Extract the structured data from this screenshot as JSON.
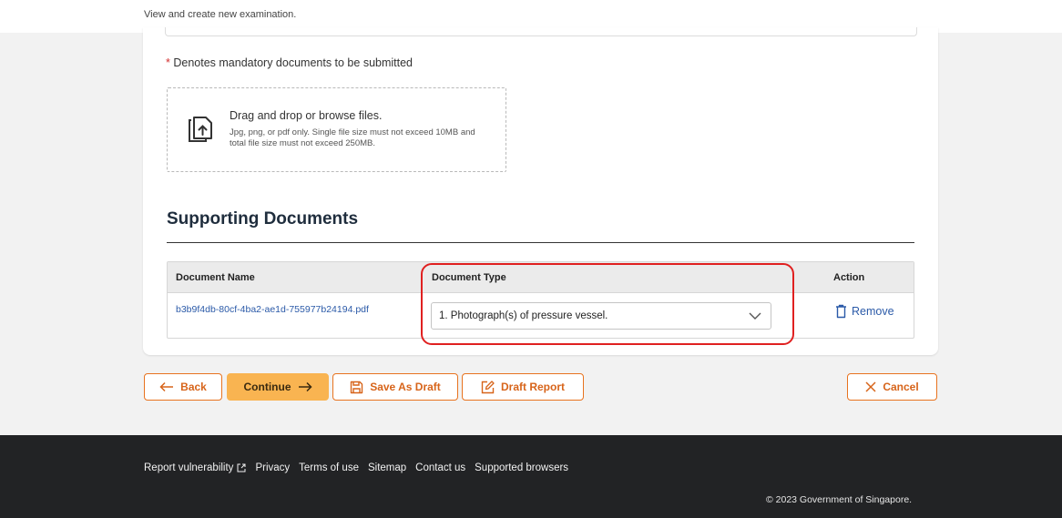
{
  "header": {
    "subtitle": "View and create new examination."
  },
  "uploads": {
    "mandatory_asterisk": "*",
    "mandatory_note": "Denotes mandatory documents to be submitted",
    "dropzone_title": "Drag and drop or browse files.",
    "dropzone_hint": "Jpg, png, or pdf only. Single file size must not exceed 10MB and total file size must not exceed 250MB.",
    "icon": "file-upload-icon"
  },
  "supporting_documents": {
    "title": "Supporting Documents",
    "columns": [
      "Document Name",
      "Document Type",
      "Action"
    ],
    "rows": [
      {
        "name": "b3b9f4db-80cf-4ba2-ae1d-755977b24194.pdf",
        "type": "1. Photograph(s) of pressure vessel.",
        "action": "Remove"
      }
    ]
  },
  "actions": {
    "back": "Back",
    "continue": "Continue",
    "save_draft": "Save As Draft",
    "draft_report": "Draft Report",
    "cancel": "Cancel"
  },
  "footer": {
    "links": [
      "Report vulnerability",
      "Privacy",
      "Terms of use",
      "Sitemap",
      "Contact us",
      "Supported browsers"
    ],
    "copyright": "© 2023 Government of Singapore."
  },
  "colors": {
    "accent": "#e8731f",
    "primary_button": "#f9b451",
    "link": "#2b5aa8",
    "highlight": "#e02020",
    "footer_bg": "#222325"
  }
}
